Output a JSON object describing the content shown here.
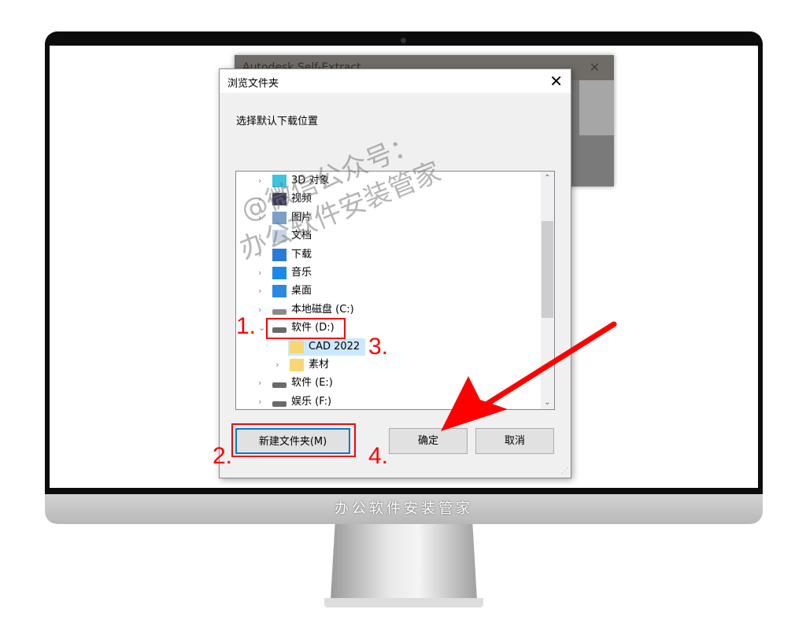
{
  "monitor": {
    "brand_text": "办公软件安装管家"
  },
  "background_window": {
    "title": "Autodesk Self-Extract",
    "close": "✕"
  },
  "dialog": {
    "title": "浏览文件夹",
    "close": "✕",
    "prompt": "选择默认下载位置",
    "tree": [
      {
        "label": "3D 对象",
        "icon": "3d-objects-icon",
        "expander": "›",
        "depth": 0
      },
      {
        "label": "视频",
        "icon": "video-icon",
        "expander": "›",
        "depth": 0
      },
      {
        "label": "图片",
        "icon": "pictures-icon",
        "expander": "›",
        "depth": 0
      },
      {
        "label": "文档",
        "icon": "documents-icon",
        "expander": "›",
        "depth": 0
      },
      {
        "label": "下载",
        "icon": "download-icon",
        "expander": "›",
        "depth": 0
      },
      {
        "label": "音乐",
        "icon": "music-icon",
        "expander": "›",
        "depth": 0
      },
      {
        "label": "桌面",
        "icon": "desktop-icon",
        "expander": "›",
        "depth": 0
      },
      {
        "label": "本地磁盘 (C:)",
        "icon": "windows-drive-icon",
        "expander": "›",
        "depth": 0
      },
      {
        "label": "软件 (D:)",
        "icon": "drive-icon",
        "expander": "⌄",
        "depth": 0
      },
      {
        "label": "CAD 2022",
        "icon": "folder-icon",
        "expander": "",
        "depth": 1,
        "selected": true
      },
      {
        "label": "素材",
        "icon": "folder-icon",
        "expander": "›",
        "depth": 1
      },
      {
        "label": "软件 (E:)",
        "icon": "drive-icon",
        "expander": "›",
        "depth": 0
      },
      {
        "label": "娱乐 (F:)",
        "icon": "drive-icon",
        "expander": "›",
        "depth": 0
      }
    ],
    "buttons": {
      "new_folder": "新建文件夹(M)",
      "ok": "确定",
      "cancel": "取消"
    }
  },
  "annotations": {
    "step1": "1.",
    "step2": "2.",
    "step3": "3.",
    "step4": "4.",
    "color": "#ff0000"
  },
  "watermark": {
    "line1": "@微信公众号：",
    "line2": "办公软件安装管家"
  }
}
